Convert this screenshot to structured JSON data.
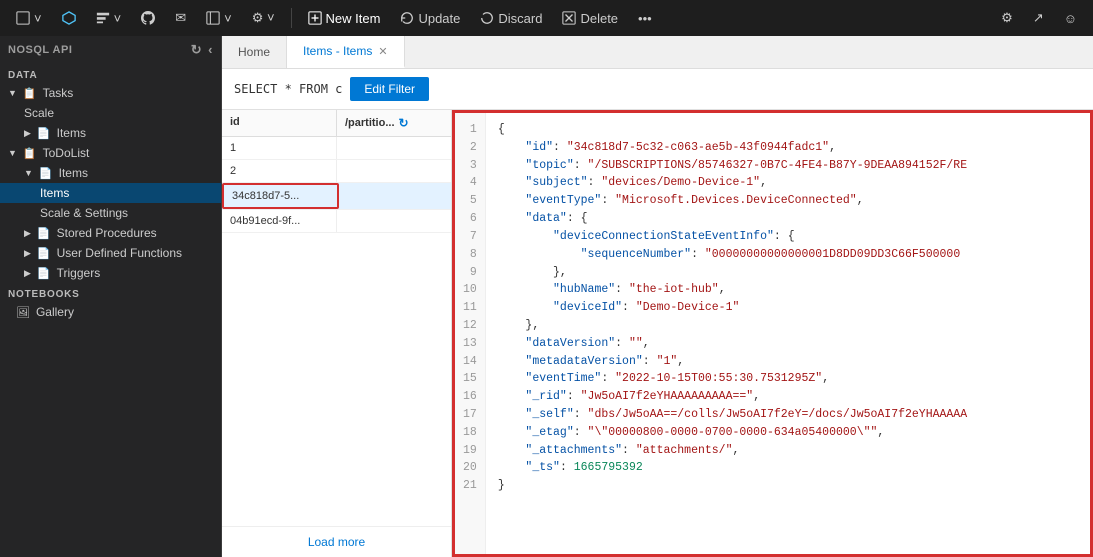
{
  "toolbar": {
    "buttons": [
      {
        "label": "◻ ˅",
        "name": "file-menu"
      },
      {
        "label": "⬡",
        "name": "cosmos-icon"
      },
      {
        "label": "◻ ˅",
        "name": "view-menu"
      },
      {
        "label": "◉",
        "name": "github-icon"
      },
      {
        "label": "✉",
        "name": "mail-icon"
      },
      {
        "label": "▭ ˅",
        "name": "panel-menu"
      },
      {
        "label": "⚙ ˅",
        "name": "settings-menu"
      }
    ],
    "new_item": "New Item",
    "update": "Update",
    "discard": "Discard",
    "delete": "Delete",
    "more": "•••"
  },
  "sidebar": {
    "title": "NOSQL API",
    "section_data": "DATA",
    "items": [
      {
        "label": "Tasks",
        "level": 1,
        "icon": "📋",
        "chevron": "▼",
        "name": "tasks"
      },
      {
        "label": "Scale",
        "level": 2,
        "icon": "",
        "chevron": "",
        "name": "scale-tasks"
      },
      {
        "label": "Items",
        "level": 2,
        "icon": "📄",
        "chevron": "▶",
        "name": "items-tasks"
      },
      {
        "label": "ToDoList",
        "level": 1,
        "icon": "📋",
        "chevron": "▼",
        "name": "todolist"
      },
      {
        "label": "Items",
        "level": 2,
        "icon": "📄",
        "chevron": "▼",
        "name": "items-todolist"
      },
      {
        "label": "Items",
        "level": 3,
        "icon": "",
        "chevron": "",
        "name": "items-active"
      },
      {
        "label": "Scale & Settings",
        "level": 3,
        "icon": "",
        "chevron": "",
        "name": "scale-settings"
      },
      {
        "label": "Stored Procedures",
        "level": 2,
        "icon": "📄",
        "chevron": "▶",
        "name": "stored-procedures"
      },
      {
        "label": "User Defined Functions",
        "level": 2,
        "icon": "📄",
        "chevron": "▶",
        "name": "user-defined-functions"
      },
      {
        "label": "Triggers",
        "level": 2,
        "icon": "📄",
        "chevron": "▶",
        "name": "triggers"
      }
    ],
    "section_notebooks": "NOTEBOOKS",
    "gallery": "Gallery"
  },
  "tabs": [
    {
      "label": "Home",
      "active": false,
      "closeable": false,
      "name": "home-tab"
    },
    {
      "label": "Items - Items",
      "active": true,
      "closeable": true,
      "name": "items-tab"
    }
  ],
  "filter": {
    "query": "SELECT * FROM c",
    "button": "Edit Filter"
  },
  "table": {
    "col_id": "id",
    "col_partition": "/partitio...",
    "rows": [
      {
        "id": "1",
        "partition": "",
        "selected": false
      },
      {
        "id": "2",
        "partition": "",
        "selected": false
      },
      {
        "id": "34c818d7-5...",
        "partition": "",
        "selected": true
      },
      {
        "id": "04b91ecd-9f...",
        "partition": "",
        "selected": false
      }
    ],
    "load_more": "Load more"
  },
  "json": {
    "lines": [
      {
        "num": 1,
        "content": "{"
      },
      {
        "num": 2,
        "content": "    \"id\": \"34c818d7-5c32-c063-ae5b-43f0944fadc1\","
      },
      {
        "num": 3,
        "content": "    \"topic\": \"/SUBSCRIPTIONS/85746327-0B7C-4FE4-B87Y-9DEAA894152F/RE"
      },
      {
        "num": 4,
        "content": "    \"subject\": \"devices/Demo-Device-1\","
      },
      {
        "num": 5,
        "content": "    \"eventType\": \"Microsoft.Devices.DeviceConnected\","
      },
      {
        "num": 6,
        "content": "    \"data\": {"
      },
      {
        "num": 7,
        "content": "        \"deviceConnectionStateEventInfo\": {"
      },
      {
        "num": 8,
        "content": "            \"sequenceNumber\": \"00000000000000001D8DD09DD3C66F500000"
      },
      {
        "num": 9,
        "content": "        },"
      },
      {
        "num": 10,
        "content": "        \"hubName\": \"the-iot-hub\","
      },
      {
        "num": 11,
        "content": "        \"deviceId\": \"Demo-Device-1\""
      },
      {
        "num": 12,
        "content": "    },"
      },
      {
        "num": 13,
        "content": "    \"dataVersion\": \"\","
      },
      {
        "num": 14,
        "content": "    \"metadataVersion\": \"1\","
      },
      {
        "num": 15,
        "content": "    \"eventTime\": \"2022-10-15T00:55:30.7531295Z\","
      },
      {
        "num": 16,
        "content": "    \"_rid\": \"Jw5oAI7f2eYHAAAAAAAAA==\","
      },
      {
        "num": 17,
        "content": "    \"_self\": \"dbs/Jw5oAA==/colls/Jw5oAI7f2eY=/docs/Jw5oAI7f2eYHAAAAA"
      },
      {
        "num": 18,
        "content": "    \"_etag\": \"\\\"00000800-0000-0700-0000-634a05400000\\\"\","
      },
      {
        "num": 19,
        "content": "    \"_attachments\": \"attachments/\","
      },
      {
        "num": 20,
        "content": "    \"_ts\": 1665795392"
      },
      {
        "num": 21,
        "content": "}"
      }
    ]
  }
}
